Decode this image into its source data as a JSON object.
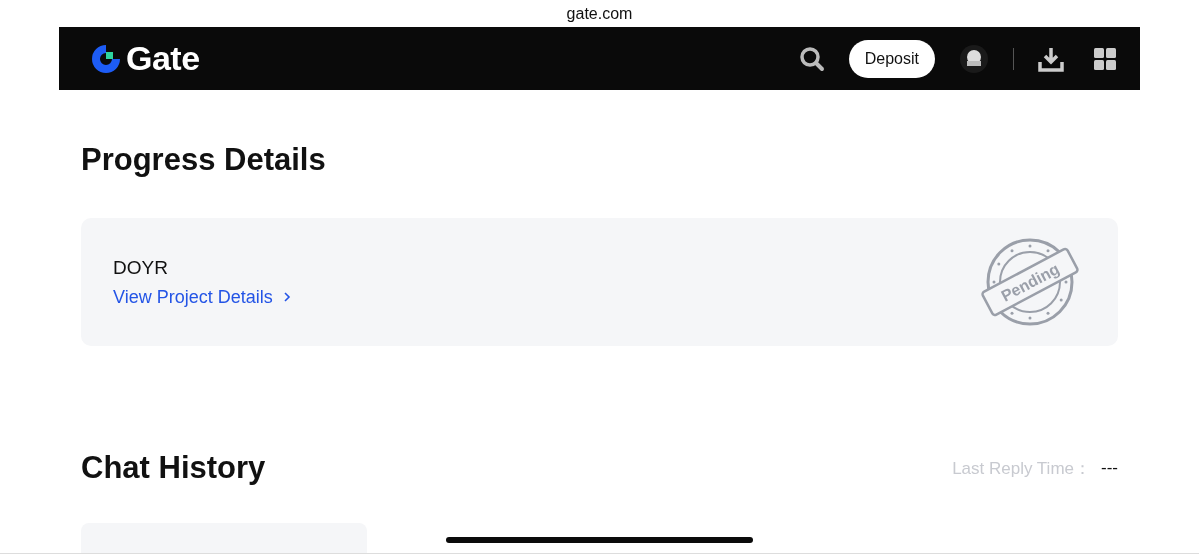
{
  "browser": {
    "address": "gate.com"
  },
  "header": {
    "logo": "Gate",
    "deposit_button": "Deposit"
  },
  "progress": {
    "title": "Progress Details",
    "project": {
      "name": "DOYR",
      "link": "View Project Details",
      "status": {
        "kind": "pending",
        "label": "Pending"
      }
    }
  },
  "chat": {
    "title": "Chat History",
    "last_reply_label": "Last Reply Time：",
    "last_reply_value": "---"
  }
}
